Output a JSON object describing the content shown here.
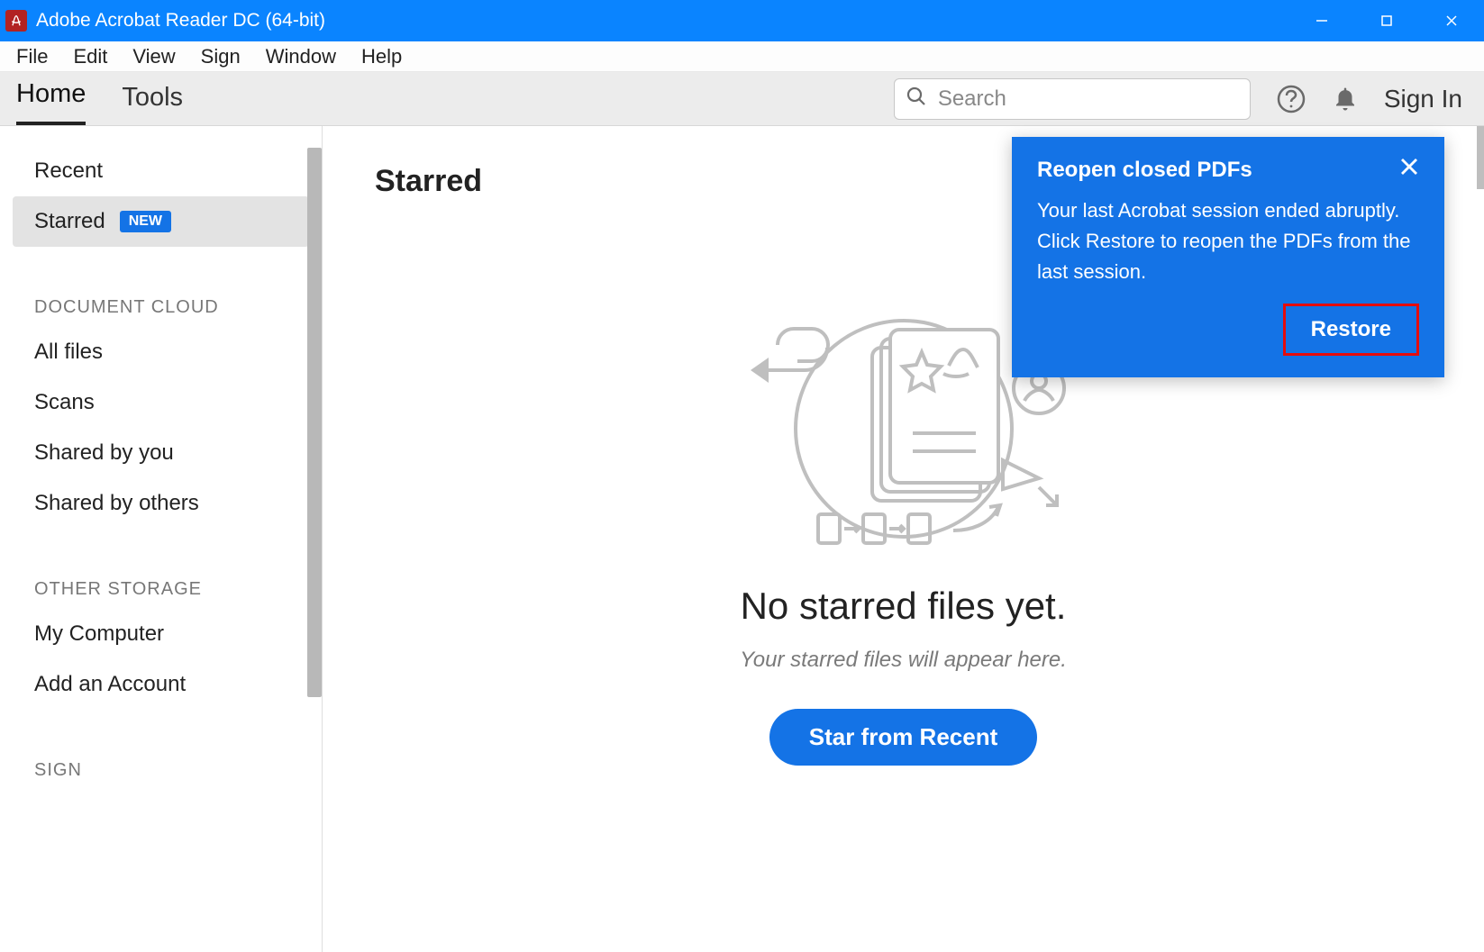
{
  "titlebar": {
    "app_name": "Adobe Acrobat Reader DC (64-bit)"
  },
  "menubar": {
    "items": [
      "File",
      "Edit",
      "View",
      "Sign",
      "Window",
      "Help"
    ]
  },
  "apptabs": {
    "home": "Home",
    "tools": "Tools",
    "search_placeholder": "Search",
    "signin": "Sign In"
  },
  "sidebar": {
    "recent": "Recent",
    "starred": "Starred",
    "starred_badge": "NEW",
    "section_cloud": "DOCUMENT CLOUD",
    "all_files": "All files",
    "scans": "Scans",
    "shared_by_you": "Shared by you",
    "shared_by_others": "Shared by others",
    "section_other": "OTHER STORAGE",
    "my_computer": "My Computer",
    "add_account": "Add an Account",
    "section_sign": "SIGN"
  },
  "main": {
    "title": "Starred",
    "empty_heading": "No starred files yet.",
    "empty_sub": "Your starred files will appear here.",
    "star_button": "Star from Recent"
  },
  "dialog": {
    "title": "Reopen closed PDFs",
    "body": "Your last Acrobat session ended abruptly. Click Restore to reopen the PDFs from the last session.",
    "restore": "Restore"
  }
}
